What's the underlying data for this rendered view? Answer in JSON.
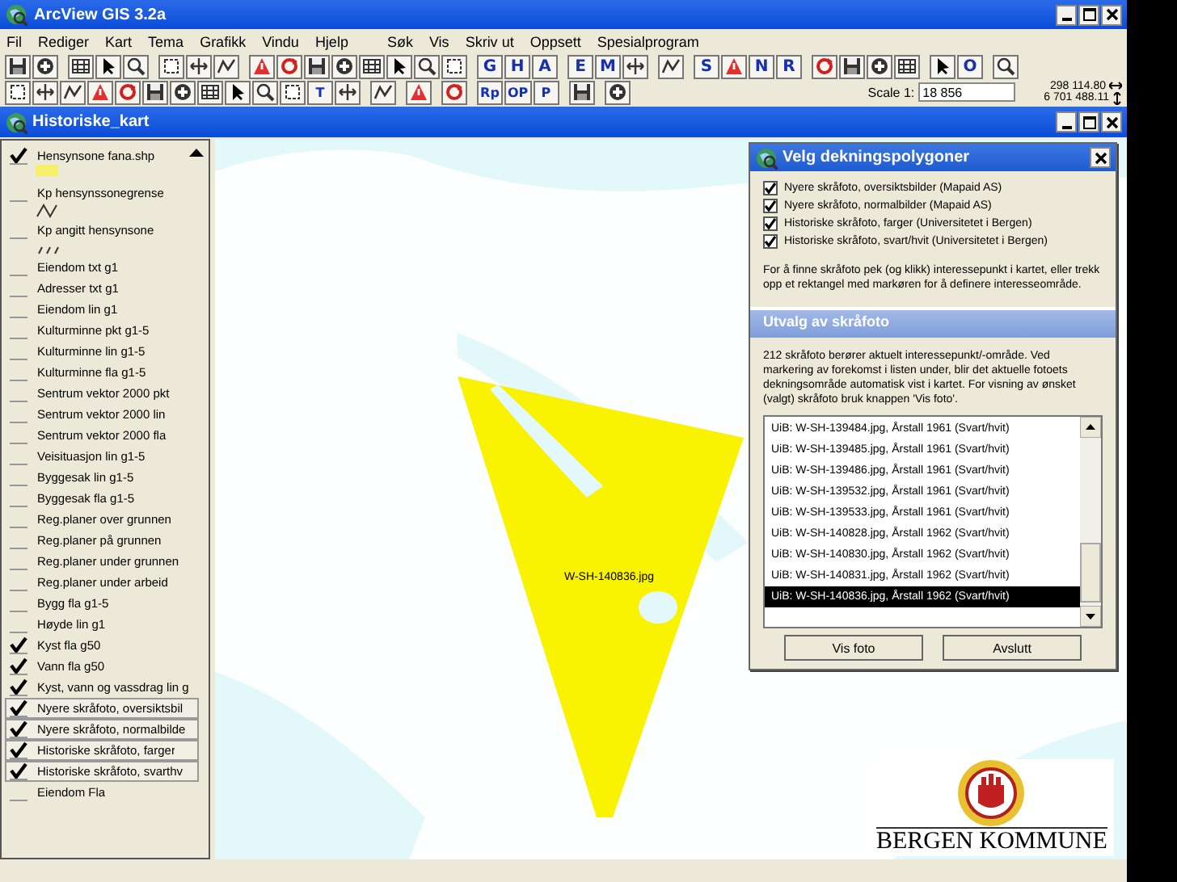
{
  "window": {
    "title": "ArcView GIS 3.2a"
  },
  "menu": [
    "Fil",
    "Rediger",
    "Kart",
    "Tema",
    "Grafikk",
    "Vindu",
    "Hjelp",
    "Søk",
    "Vis",
    "Skriv ut",
    "Oppsett",
    "Spesialprogram"
  ],
  "toolbar": [
    [
      {
        "kind": "icon"
      },
      {
        "kind": "icon"
      }
    ],
    [
      {
        "kind": "icon"
      },
      {
        "kind": "icon"
      },
      {
        "kind": "icon"
      }
    ],
    [
      {
        "kind": "icon"
      },
      {
        "kind": "icon"
      },
      {
        "kind": "icon"
      }
    ],
    [
      {
        "kind": "icon"
      },
      {
        "kind": "icon"
      },
      {
        "kind": "icon"
      },
      {
        "kind": "icon"
      },
      {
        "kind": "icon"
      },
      {
        "kind": "icon"
      },
      {
        "kind": "icon"
      },
      {
        "kind": "icon"
      }
    ],
    [
      {
        "kind": "letter",
        "label": "G"
      },
      {
        "kind": "letter",
        "label": "H"
      },
      {
        "kind": "letter",
        "label": "A"
      }
    ],
    [
      {
        "kind": "letter",
        "label": "E"
      },
      {
        "kind": "letter",
        "label": "M"
      },
      {
        "kind": "icon"
      }
    ],
    [
      {
        "kind": "icon"
      }
    ],
    [
      {
        "kind": "letter",
        "label": "S"
      },
      {
        "kind": "icon"
      },
      {
        "kind": "letter",
        "label": "N"
      },
      {
        "kind": "letter",
        "label": "R"
      }
    ],
    [
      {
        "kind": "icon"
      },
      {
        "kind": "icon"
      },
      {
        "kind": "icon"
      },
      {
        "kind": "icon"
      }
    ],
    [
      {
        "kind": "icon"
      },
      {
        "kind": "letter",
        "label": "O"
      }
    ],
    [
      {
        "kind": "icon"
      }
    ]
  ],
  "toolbar_2": [
    [
      {
        "kind": "icon"
      },
      {
        "kind": "icon"
      },
      {
        "kind": "icon"
      },
      {
        "kind": "icon"
      },
      {
        "kind": "icon"
      },
      {
        "kind": "icon"
      },
      {
        "kind": "icon"
      },
      {
        "kind": "icon"
      },
      {
        "kind": "icon"
      },
      {
        "kind": "icon"
      },
      {
        "kind": "icon"
      },
      {
        "kind": "letter",
        "label": "T"
      },
      {
        "kind": "icon"
      }
    ],
    [
      {
        "kind": "icon"
      }
    ],
    [
      {
        "kind": "icon"
      }
    ],
    [
      {
        "kind": "icon"
      }
    ],
    [
      {
        "kind": "letter",
        "label": "Rp"
      },
      {
        "kind": "letter",
        "label": "OP"
      },
      {
        "kind": "letter",
        "label": "P"
      }
    ],
    [
      {
        "kind": "icon"
      }
    ],
    [
      {
        "kind": "icon"
      }
    ]
  ],
  "scale": {
    "label": "Scale 1:",
    "value": "18 856"
  },
  "coordinates": {
    "x": "298 114.80",
    "y": "6 701 488.11"
  },
  "view": {
    "title": "Historiske_kart"
  },
  "legend": [
    {
      "label": "Hensynsone fana.shp",
      "checked": true,
      "selected": false,
      "kind": "patch"
    },
    {
      "label": "Kp hensynssonegrense",
      "checked": false,
      "selected": false,
      "kind": "line"
    },
    {
      "label": "Kp angitt hensynsone",
      "checked": false,
      "selected": false,
      "kind": "dash"
    },
    {
      "label": "Eiendom txt g1",
      "checked": false,
      "selected": false
    },
    {
      "label": "Adresser txt g1",
      "checked": false,
      "selected": false
    },
    {
      "label": "Eiendom lin g1",
      "checked": false,
      "selected": false
    },
    {
      "label": "Kulturminne pkt g1-5",
      "checked": false,
      "selected": false
    },
    {
      "label": "Kulturminne lin g1-5",
      "checked": false,
      "selected": false
    },
    {
      "label": "Kulturminne fla g1-5",
      "checked": false,
      "selected": false
    },
    {
      "label": "Sentrum vektor 2000 pkt",
      "checked": false,
      "selected": false
    },
    {
      "label": "Sentrum vektor 2000 lin",
      "checked": false,
      "selected": false
    },
    {
      "label": "Sentrum vektor 2000 fla",
      "checked": false,
      "selected": false
    },
    {
      "label": "Veisituasjon lin g1-5",
      "checked": false,
      "selected": false
    },
    {
      "label": "Byggesak lin g1-5",
      "checked": false,
      "selected": false
    },
    {
      "label": "Byggesak fla g1-5",
      "checked": false,
      "selected": false
    },
    {
      "label": "Reg.planer over grunnen",
      "checked": false,
      "selected": false
    },
    {
      "label": "Reg.planer på grunnen",
      "checked": false,
      "selected": false
    },
    {
      "label": "Reg.planer under grunnen",
      "checked": false,
      "selected": false
    },
    {
      "label": "Reg.planer under arbeid",
      "checked": false,
      "selected": false
    },
    {
      "label": "Bygg fla g1-5",
      "checked": false,
      "selected": false
    },
    {
      "label": "Høyde lin g1",
      "checked": false,
      "selected": false
    },
    {
      "label": "Kyst fla g50",
      "checked": true,
      "selected": false
    },
    {
      "label": "Vann fla g50",
      "checked": true,
      "selected": false
    },
    {
      "label": "Kyst, vann og vassdrag lin g",
      "checked": true,
      "selected": false
    },
    {
      "label": "Nyere skråfoto, oversiktsbil",
      "checked": true,
      "selected": true
    },
    {
      "label": "Nyere skråfoto, normalbilde",
      "checked": true,
      "selected": true
    },
    {
      "label": "Historiske skråfoto, farger",
      "checked": true,
      "selected": true
    },
    {
      "label": "Historiske skråfoto, svarthv",
      "checked": true,
      "selected": true
    },
    {
      "label": "Eiendom Fla",
      "checked": false,
      "selected": false
    }
  ],
  "map": {
    "photo_label": "W-SH-140836.jpg"
  },
  "dialog": {
    "title": "Velg dekningspolygoner",
    "options": [
      {
        "label": "Nyere skråfoto, oversiktsbilder (Mapaid AS)",
        "checked": true
      },
      {
        "label": "Nyere skråfoto, normalbilder (Mapaid AS)",
        "checked": true
      },
      {
        "label": "Historiske skråfoto, farger (Universitetet i Bergen)",
        "checked": true
      },
      {
        "label": "Historiske skråfoto, svart/hvit (Universitetet i Bergen)",
        "checked": true
      }
    ],
    "instructions": "For å finne skråfoto pek (og klikk) interessepunkt i kartet, eller trekk opp et rektangel med markøren for å definere interesseområde.",
    "section": "Utvalg av skråfoto",
    "summary": "212 skråfoto berører aktuelt interessepunkt/-område. Ved markering av forekomst i listen under, blir det aktuelle fotoets dekningsområde automatisk vist i kartet. For visning av ønsket (valgt) skråfoto bruk knappen 'Vis foto'.",
    "photos": [
      {
        "label": "UiB: W-SH-139484.jpg, Årstall 1961 (Svart/hvit)",
        "selected": false
      },
      {
        "label": "UiB: W-SH-139485.jpg, Årstall 1961 (Svart/hvit)",
        "selected": false
      },
      {
        "label": "UiB: W-SH-139486.jpg, Årstall 1961 (Svart/hvit)",
        "selected": false
      },
      {
        "label": "UiB: W-SH-139532.jpg, Årstall 1961 (Svart/hvit)",
        "selected": false
      },
      {
        "label": "UiB: W-SH-139533.jpg, Årstall 1961 (Svart/hvit)",
        "selected": false
      },
      {
        "label": "UiB: W-SH-140828.jpg, Årstall 1962 (Svart/hvit)",
        "selected": false
      },
      {
        "label": "UiB: W-SH-140830.jpg, Årstall 1962 (Svart/hvit)",
        "selected": false
      },
      {
        "label": "UiB: W-SH-140831.jpg, Årstall 1962 (Svart/hvit)",
        "selected": false
      },
      {
        "label": "UiB: W-SH-140836.jpg, Årstall 1962 (Svart/hvit)",
        "selected": true
      }
    ],
    "buttons": [
      "Vis foto",
      "Avslutt"
    ]
  },
  "logo": {
    "text": "BERGEN KOMMUNE"
  }
}
